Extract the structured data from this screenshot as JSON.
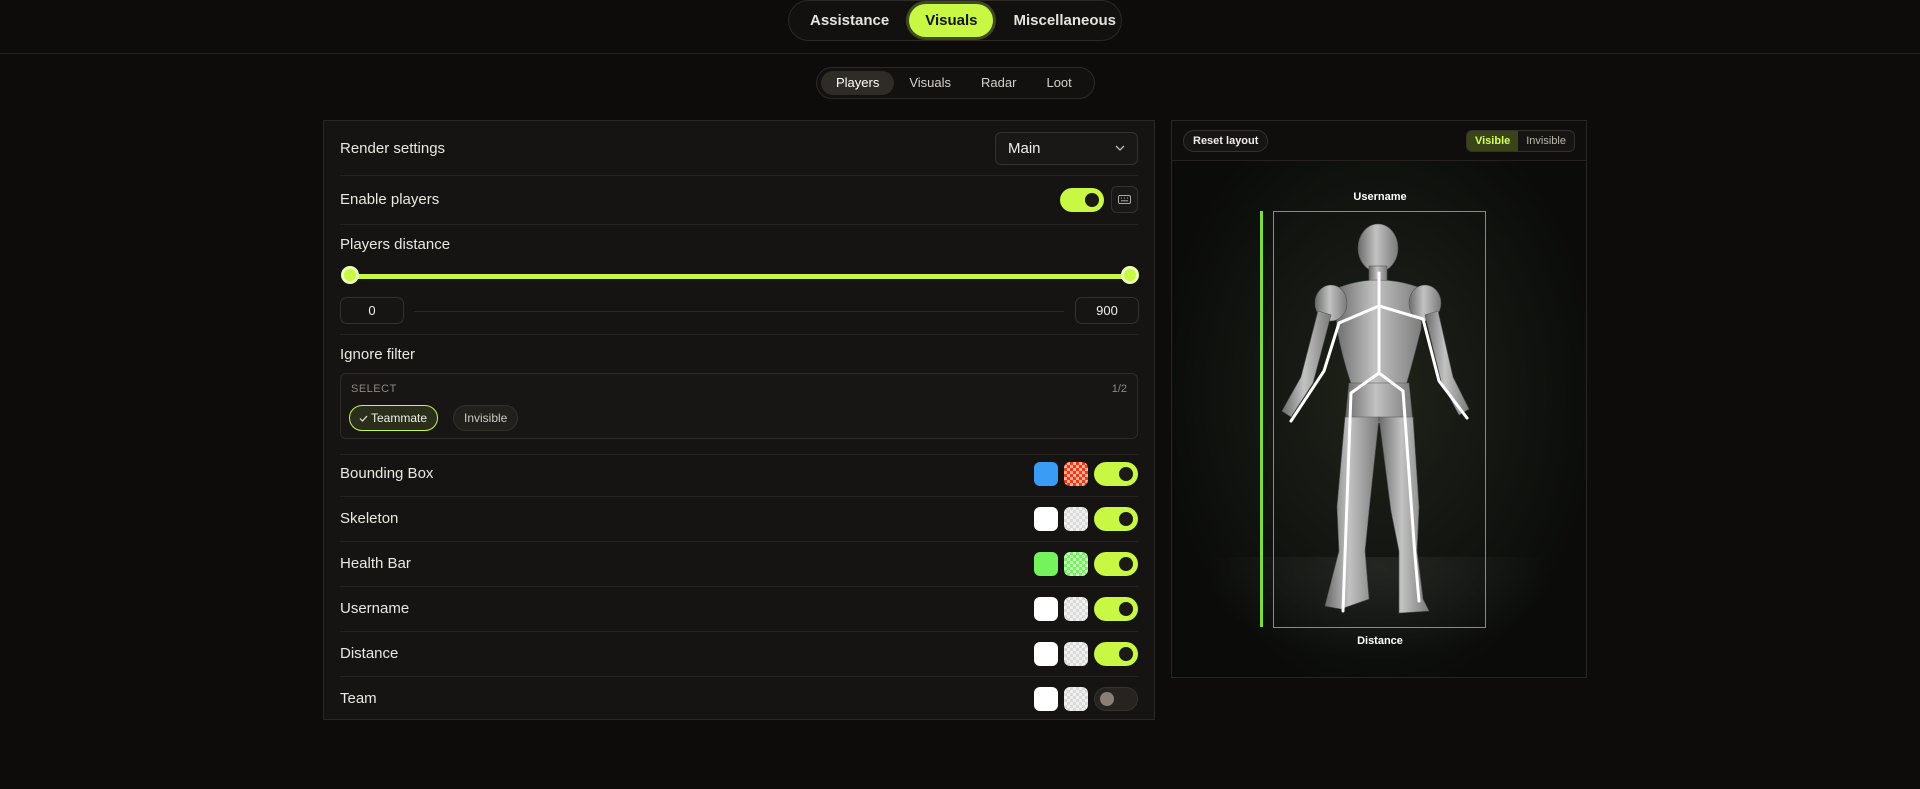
{
  "top_tabs": [
    "Assistance",
    "Visuals",
    "Miscellaneous"
  ],
  "top_tab_active": "Visuals",
  "sub_tabs": [
    "Players",
    "Visuals",
    "Radar",
    "Loot"
  ],
  "sub_tab_active": "Players",
  "settings": {
    "render_label": "Render settings",
    "render_value": "Main",
    "enable_label": "Enable players",
    "enable_on": true,
    "distance_label": "Players distance",
    "distance_min": "0",
    "distance_max": "900",
    "filter_label": "Ignore filter",
    "filter_head": "SELECT",
    "filter_count": "1/2",
    "filter_chip_selected": "Teammate",
    "filter_chip_unselected": "Invisible",
    "rows": [
      {
        "label": "Bounding Box",
        "color1": "#3b9cf5",
        "color2": "#f03a12",
        "on": true
      },
      {
        "label": "Skeleton",
        "color1": "#ffffff",
        "color2": "#d9d9d9",
        "on": true
      },
      {
        "label": "Health Bar",
        "color1": "#74f35c",
        "color2": "#74f35c",
        "on": true
      },
      {
        "label": "Username",
        "color1": "#ffffff",
        "color2": "#d9d9d9",
        "on": true
      },
      {
        "label": "Distance",
        "color1": "#ffffff",
        "color2": "#d9d9d9",
        "on": true
      },
      {
        "label": "Team",
        "color1": "#ffffff",
        "color2": "#d9d9d9",
        "on": false
      }
    ]
  },
  "preview": {
    "reset_label": "Reset layout",
    "visible_label": "Visible",
    "invisible_label": "Invisible",
    "visibility_selected": "Visible",
    "username_label": "Username",
    "distance_label": "Distance"
  },
  "colors": {
    "accent": "#c8f744",
    "bbox": "#37a0f2",
    "health": "#7ddc3f"
  }
}
